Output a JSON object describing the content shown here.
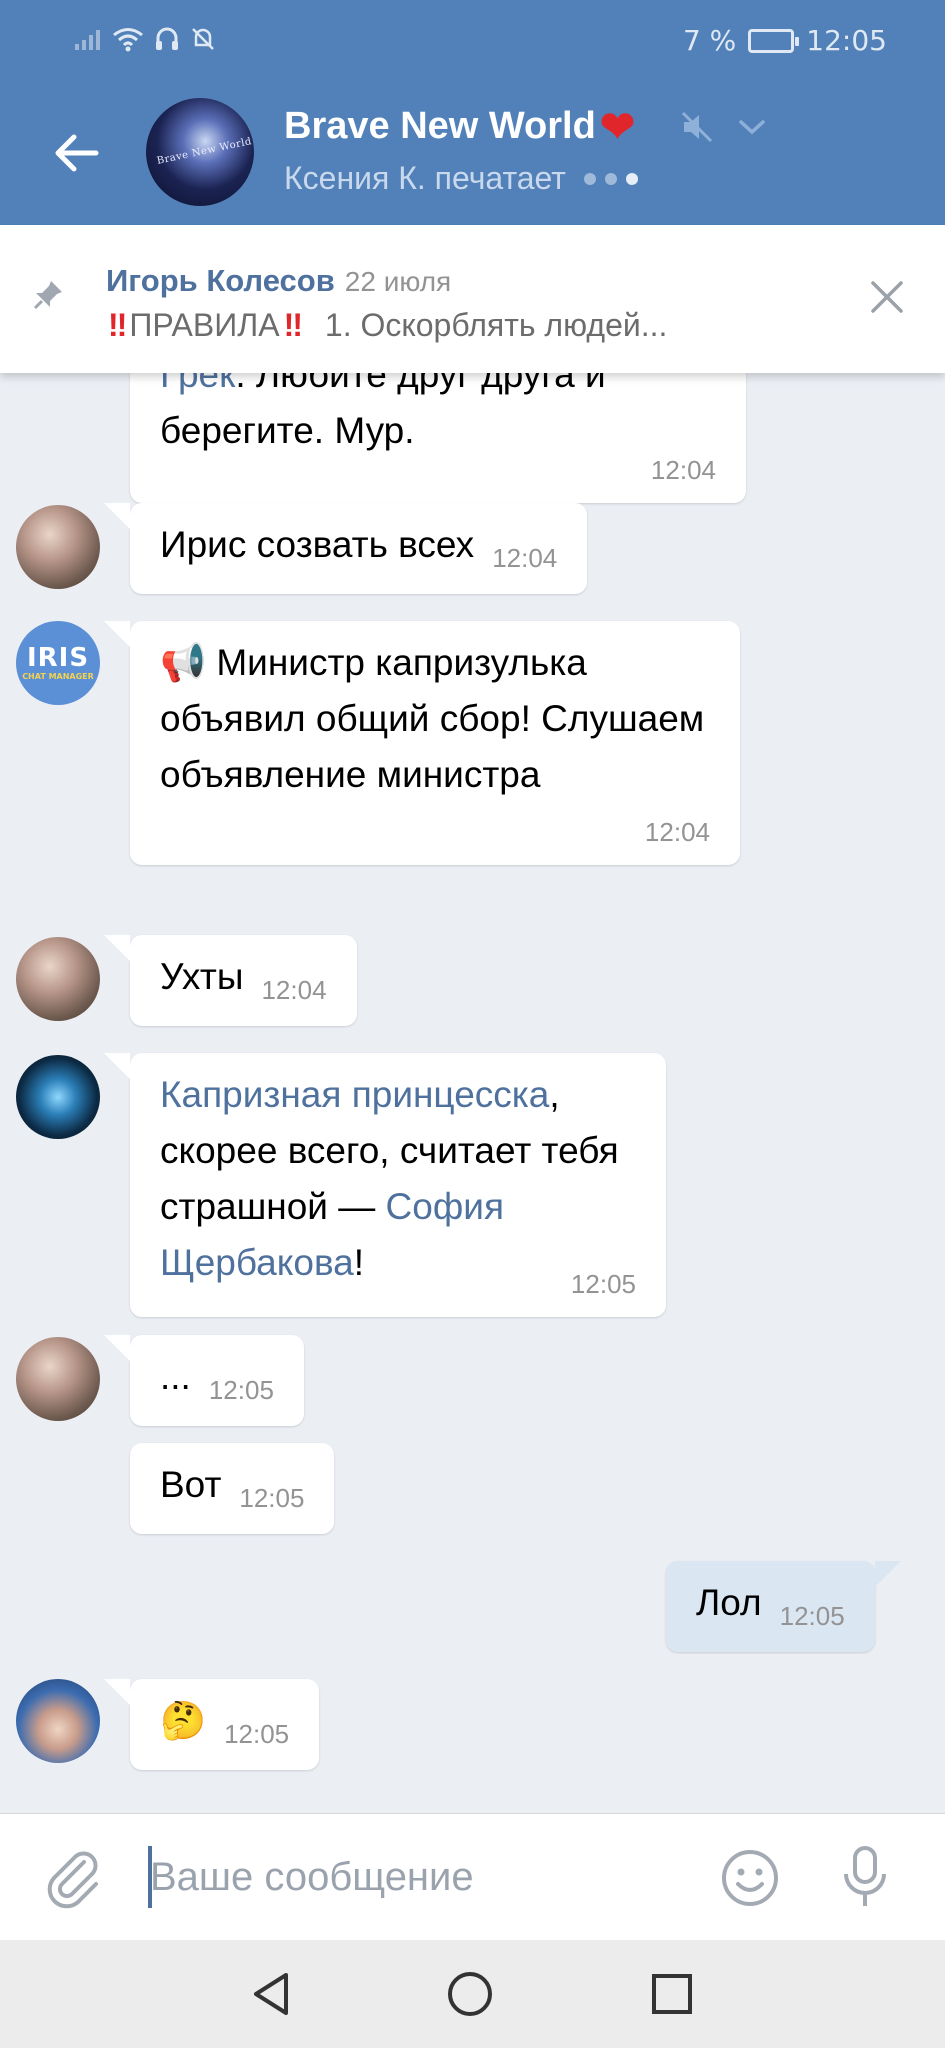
{
  "status_bar": {
    "battery_text": "7 %",
    "time": "12:05"
  },
  "header": {
    "title": "Brave New World",
    "title_emoji": "❤",
    "subtitle": "Ксения К. печатает",
    "avatar_text": "Brave New World"
  },
  "pinned": {
    "author": "Игорь Колесов",
    "date": "22 июля",
    "bang": "‼",
    "rules": "ПРАВИЛА",
    "text": "1. Оскорблять людей..."
  },
  "messages": [
    {
      "id": "m1",
      "text_before_link": "",
      "link": "Грек",
      "text": ". Любите друг друга и берегите. Мур.",
      "time": "12:04"
    },
    {
      "id": "m2",
      "text": "Ирис созвать всех",
      "time": "12:04"
    },
    {
      "id": "m3",
      "emoji": "📢",
      "text": "Министр капризулька объявил общий сбор! Слушаем объявление министра",
      "time": "12:04",
      "avatar_big": "IRIS",
      "avatar_small": "CHAT MANAGER"
    },
    {
      "id": "m4",
      "text": "Ухты",
      "time": "12:04"
    },
    {
      "id": "m5",
      "link1": "Капризная принцесска",
      "mid": ", скорее всего, считает тебя страшной — ",
      "link2": "София Щербакова",
      "end": "!",
      "time": "12:05"
    },
    {
      "id": "m6",
      "text": "...",
      "time": "12:05"
    },
    {
      "id": "m7",
      "text": "Вот",
      "time": "12:05"
    },
    {
      "id": "m8",
      "text": "Лол",
      "time": "12:05"
    },
    {
      "id": "m9",
      "text": "🤔",
      "time": "12:05"
    }
  ],
  "composer": {
    "placeholder": "Ваше сообщение"
  },
  "colors": {
    "header": "#5181b8",
    "background": "#ebeff4",
    "link": "#4f719e",
    "outgoing_bubble": "#dbe6f3"
  }
}
